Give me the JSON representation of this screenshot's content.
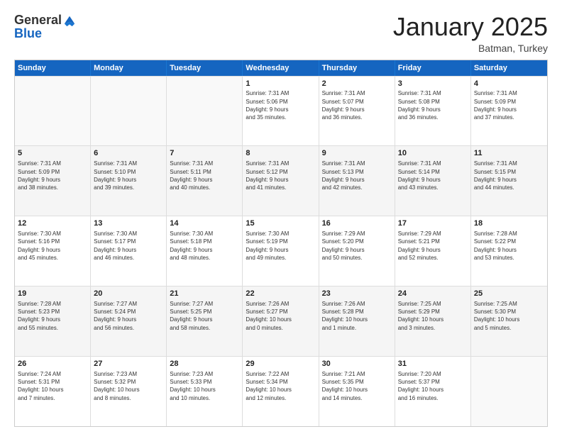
{
  "logo": {
    "general": "General",
    "blue": "Blue"
  },
  "title": "January 2025",
  "subtitle": "Batman, Turkey",
  "days": [
    "Sunday",
    "Monday",
    "Tuesday",
    "Wednesday",
    "Thursday",
    "Friday",
    "Saturday"
  ],
  "rows": [
    [
      {
        "day": "",
        "empty": true
      },
      {
        "day": "",
        "empty": true
      },
      {
        "day": "",
        "empty": true
      },
      {
        "day": "1",
        "lines": [
          "Sunrise: 7:31 AM",
          "Sunset: 5:06 PM",
          "Daylight: 9 hours",
          "and 35 minutes."
        ]
      },
      {
        "day": "2",
        "lines": [
          "Sunrise: 7:31 AM",
          "Sunset: 5:07 PM",
          "Daylight: 9 hours",
          "and 36 minutes."
        ]
      },
      {
        "day": "3",
        "lines": [
          "Sunrise: 7:31 AM",
          "Sunset: 5:08 PM",
          "Daylight: 9 hours",
          "and 36 minutes."
        ]
      },
      {
        "day": "4",
        "lines": [
          "Sunrise: 7:31 AM",
          "Sunset: 5:09 PM",
          "Daylight: 9 hours",
          "and 37 minutes."
        ]
      }
    ],
    [
      {
        "day": "5",
        "lines": [
          "Sunrise: 7:31 AM",
          "Sunset: 5:09 PM",
          "Daylight: 9 hours",
          "and 38 minutes."
        ]
      },
      {
        "day": "6",
        "lines": [
          "Sunrise: 7:31 AM",
          "Sunset: 5:10 PM",
          "Daylight: 9 hours",
          "and 39 minutes."
        ]
      },
      {
        "day": "7",
        "lines": [
          "Sunrise: 7:31 AM",
          "Sunset: 5:11 PM",
          "Daylight: 9 hours",
          "and 40 minutes."
        ]
      },
      {
        "day": "8",
        "lines": [
          "Sunrise: 7:31 AM",
          "Sunset: 5:12 PM",
          "Daylight: 9 hours",
          "and 41 minutes."
        ]
      },
      {
        "day": "9",
        "lines": [
          "Sunrise: 7:31 AM",
          "Sunset: 5:13 PM",
          "Daylight: 9 hours",
          "and 42 minutes."
        ]
      },
      {
        "day": "10",
        "lines": [
          "Sunrise: 7:31 AM",
          "Sunset: 5:14 PM",
          "Daylight: 9 hours",
          "and 43 minutes."
        ]
      },
      {
        "day": "11",
        "lines": [
          "Sunrise: 7:31 AM",
          "Sunset: 5:15 PM",
          "Daylight: 9 hours",
          "and 44 minutes."
        ]
      }
    ],
    [
      {
        "day": "12",
        "lines": [
          "Sunrise: 7:30 AM",
          "Sunset: 5:16 PM",
          "Daylight: 9 hours",
          "and 45 minutes."
        ]
      },
      {
        "day": "13",
        "lines": [
          "Sunrise: 7:30 AM",
          "Sunset: 5:17 PM",
          "Daylight: 9 hours",
          "and 46 minutes."
        ]
      },
      {
        "day": "14",
        "lines": [
          "Sunrise: 7:30 AM",
          "Sunset: 5:18 PM",
          "Daylight: 9 hours",
          "and 48 minutes."
        ]
      },
      {
        "day": "15",
        "lines": [
          "Sunrise: 7:30 AM",
          "Sunset: 5:19 PM",
          "Daylight: 9 hours",
          "and 49 minutes."
        ]
      },
      {
        "day": "16",
        "lines": [
          "Sunrise: 7:29 AM",
          "Sunset: 5:20 PM",
          "Daylight: 9 hours",
          "and 50 minutes."
        ]
      },
      {
        "day": "17",
        "lines": [
          "Sunrise: 7:29 AM",
          "Sunset: 5:21 PM",
          "Daylight: 9 hours",
          "and 52 minutes."
        ]
      },
      {
        "day": "18",
        "lines": [
          "Sunrise: 7:28 AM",
          "Sunset: 5:22 PM",
          "Daylight: 9 hours",
          "and 53 minutes."
        ]
      }
    ],
    [
      {
        "day": "19",
        "lines": [
          "Sunrise: 7:28 AM",
          "Sunset: 5:23 PM",
          "Daylight: 9 hours",
          "and 55 minutes."
        ]
      },
      {
        "day": "20",
        "lines": [
          "Sunrise: 7:27 AM",
          "Sunset: 5:24 PM",
          "Daylight: 9 hours",
          "and 56 minutes."
        ]
      },
      {
        "day": "21",
        "lines": [
          "Sunrise: 7:27 AM",
          "Sunset: 5:25 PM",
          "Daylight: 9 hours",
          "and 58 minutes."
        ]
      },
      {
        "day": "22",
        "lines": [
          "Sunrise: 7:26 AM",
          "Sunset: 5:27 PM",
          "Daylight: 10 hours",
          "and 0 minutes."
        ]
      },
      {
        "day": "23",
        "lines": [
          "Sunrise: 7:26 AM",
          "Sunset: 5:28 PM",
          "Daylight: 10 hours",
          "and 1 minute."
        ]
      },
      {
        "day": "24",
        "lines": [
          "Sunrise: 7:25 AM",
          "Sunset: 5:29 PM",
          "Daylight: 10 hours",
          "and 3 minutes."
        ]
      },
      {
        "day": "25",
        "lines": [
          "Sunrise: 7:25 AM",
          "Sunset: 5:30 PM",
          "Daylight: 10 hours",
          "and 5 minutes."
        ]
      }
    ],
    [
      {
        "day": "26",
        "lines": [
          "Sunrise: 7:24 AM",
          "Sunset: 5:31 PM",
          "Daylight: 10 hours",
          "and 7 minutes."
        ]
      },
      {
        "day": "27",
        "lines": [
          "Sunrise: 7:23 AM",
          "Sunset: 5:32 PM",
          "Daylight: 10 hours",
          "and 8 minutes."
        ]
      },
      {
        "day": "28",
        "lines": [
          "Sunrise: 7:23 AM",
          "Sunset: 5:33 PM",
          "Daylight: 10 hours",
          "and 10 minutes."
        ]
      },
      {
        "day": "29",
        "lines": [
          "Sunrise: 7:22 AM",
          "Sunset: 5:34 PM",
          "Daylight: 10 hours",
          "and 12 minutes."
        ]
      },
      {
        "day": "30",
        "lines": [
          "Sunrise: 7:21 AM",
          "Sunset: 5:35 PM",
          "Daylight: 10 hours",
          "and 14 minutes."
        ]
      },
      {
        "day": "31",
        "lines": [
          "Sunrise: 7:20 AM",
          "Sunset: 5:37 PM",
          "Daylight: 10 hours",
          "and 16 minutes."
        ]
      },
      {
        "day": "",
        "empty": true
      }
    ]
  ]
}
